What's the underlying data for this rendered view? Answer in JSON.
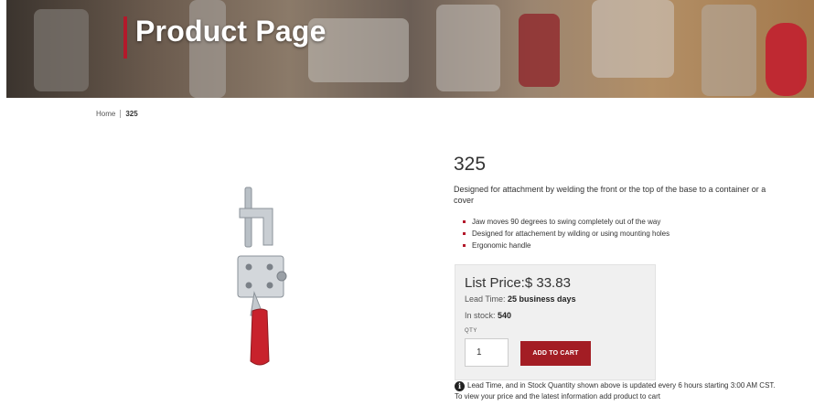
{
  "hero": {
    "title": "Product Page"
  },
  "breadcrumb": {
    "home": "Home",
    "current": "325"
  },
  "product": {
    "title": "325",
    "description": "Designed for attachment by welding the front or the top of the base to a container or a cover",
    "features": [
      "Jaw moves 90 degrees to swing completely out of the way",
      "Designed for attachement by wilding or using mounting holes",
      "Ergonomic handle"
    ]
  },
  "price_box": {
    "list_price_label": "List Price:",
    "list_price_value": "$ 33.83",
    "lead_time_label": "Lead Time: ",
    "lead_time_value": "25 business days",
    "stock_label": "In stock: ",
    "stock_value": "540",
    "qty_label": "QTY",
    "qty_value": "1",
    "add_to_cart_label": "ADD TO CART"
  },
  "notice": {
    "icon": "info-icon",
    "text": "Lead Time, and in Stock Quantity shown above is updated every 6 hours starting 3:00 AM CST. To view your price and the latest information add product to cart"
  },
  "colors": {
    "accent": "#b3192b",
    "button": "#a31d24"
  }
}
